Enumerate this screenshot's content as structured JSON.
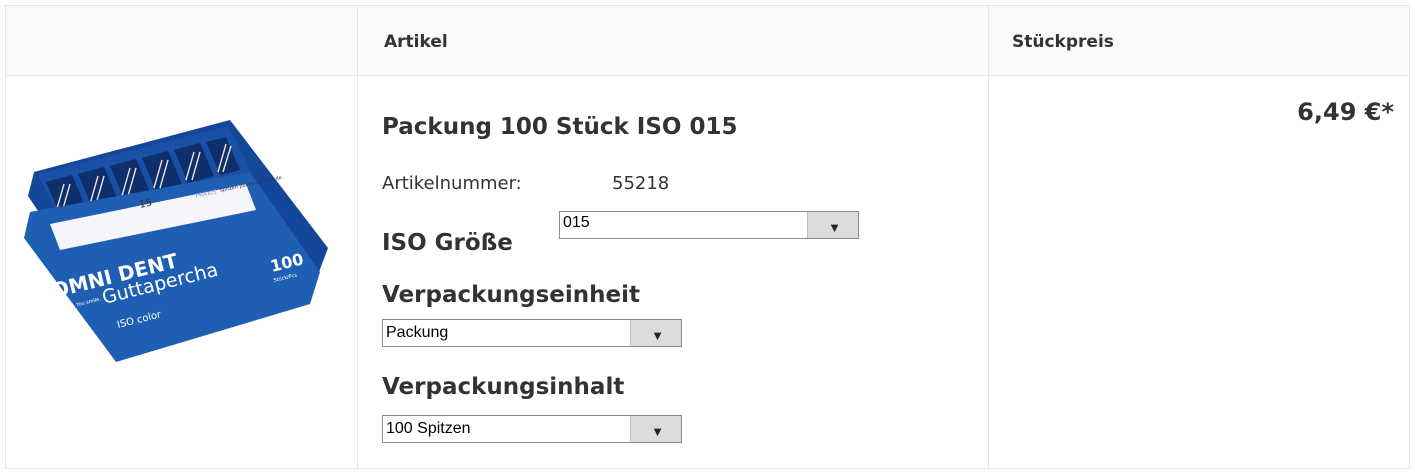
{
  "header": {
    "col_article": "Artikel",
    "col_unit_price": "Stückpreis"
  },
  "product": {
    "title": "Packung 100 Stück ISO 015",
    "article_number_label": "Artikelnummer:",
    "article_number": "55218",
    "price": "6,49 €*",
    "image_text": {
      "brand": "OMNI DENT",
      "slogan": "We care. You smile.",
      "name": "Guttapercha",
      "subtitle": "ISO color",
      "count": "100",
      "count_unit": "Stück/Pcs",
      "size": "15",
      "praxis": "PRAXIS",
      "points": "Spitzen points pointes de"
    }
  },
  "options": {
    "iso_size": {
      "label": "ISO Größe",
      "value": "015"
    },
    "packaging_unit": {
      "label": "Verpackungseinheit",
      "value": "Packung"
    },
    "packaging_content": {
      "label": "Verpackungsinhalt",
      "value": "100 Spitzen"
    }
  },
  "colors": {
    "border": "#e6e6e6",
    "header_bg": "#fafafa",
    "text": "#333333",
    "box_blue": "#1f5fb3"
  },
  "icons": {
    "select_arrow": "triangle-down-icon"
  }
}
